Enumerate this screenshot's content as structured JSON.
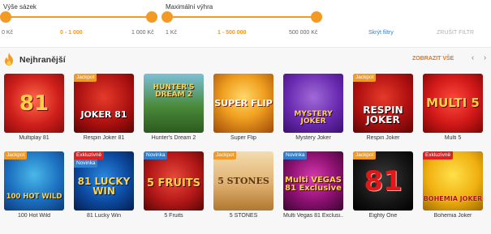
{
  "filters": {
    "stake": {
      "label": "Výše sázek",
      "min_label": "0 Kč",
      "range_label": "0 - 1 000",
      "max_label": "1 000 Kč"
    },
    "max_win": {
      "label": "Maximální výhra",
      "min_label": "1 Kč",
      "range_label": "1 - 500 000",
      "max_label": "500 000 Kč"
    },
    "hide_label": "Skrýt filtry",
    "reset_label": "ZRUŠIT FILTR"
  },
  "section": {
    "title": "Nejhranější",
    "show_all": "ZOBRAZIT VŠE",
    "prev_icon": "‹",
    "next_icon": "›"
  },
  "colors": {
    "accent": "#f39a24",
    "jackpot_badge": "#f39a24",
    "exclusive_badge": "#e02020",
    "new_badge": "#2f7fd1"
  },
  "games_row1": [
    {
      "title": "Multiplay 81",
      "badge": "",
      "art": "81"
    },
    {
      "title": "Respin Joker 81",
      "badge": "Jackpot",
      "art": "JOKER 81"
    },
    {
      "title": "Hunter's Dream 2",
      "badge": "",
      "art": "HUNTER'S DREAM 2"
    },
    {
      "title": "Super Flip",
      "badge": "",
      "art": "SUPER FLIP"
    },
    {
      "title": "Mystery Joker",
      "badge": "",
      "art": "MYSTERY JOKER"
    },
    {
      "title": "Respin Joker",
      "badge": "Jackpot",
      "art": "RESPIN JOKER"
    },
    {
      "title": "Multi 5",
      "badge": "",
      "art": "MULTI 5"
    }
  ],
  "games_row2": [
    {
      "title": "100 Hot Wild",
      "badge": "Jackpot",
      "art": "100 HOT WILD"
    },
    {
      "title": "81 Lucky Win",
      "badge": "Exkluzivně",
      "badge2": "Novinka",
      "art": "81 LUCKY WIN"
    },
    {
      "title": "5 Fruits",
      "badge": "Novinka",
      "art": "5 FRUITS"
    },
    {
      "title": "5 STONES",
      "badge": "Jackpot",
      "art": "5 STONES"
    },
    {
      "title": "Multi Vegas 81 Exclusi...",
      "badge": "Novinka",
      "art": "Multi VEGAS 81 Exclusive"
    },
    {
      "title": "Eighty One",
      "badge": "Jackpot",
      "art": "81"
    },
    {
      "title": "Bohemia Joker",
      "badge": "Exkluzivně",
      "art": "BOHEMIA JOKER"
    }
  ]
}
